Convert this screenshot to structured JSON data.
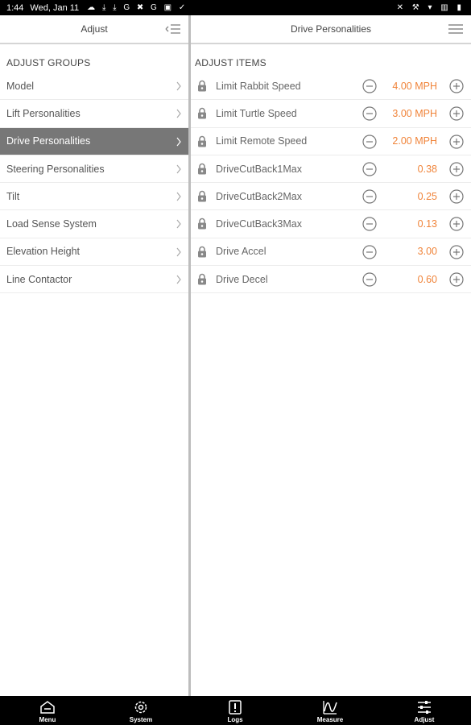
{
  "status_bar": {
    "time": "1:44",
    "date": "Wed, Jan 11",
    "notif_icons": "☁ ⤓ ⤓ G ✖ G ▣ ✓",
    "system_icons": "✕ ⚒ ▾ ▥ ▮"
  },
  "left": {
    "title": "Adjust",
    "section": "ADJUST GROUPS",
    "groups": [
      {
        "label": "Model"
      },
      {
        "label": "Lift Personalities"
      },
      {
        "label": "Drive Personalities"
      },
      {
        "label": "Steering Personalities"
      },
      {
        "label": "Tilt"
      },
      {
        "label": "Load Sense System"
      },
      {
        "label": "Elevation Height"
      },
      {
        "label": "Line Contactor"
      }
    ],
    "selected": "Drive Personalities"
  },
  "right": {
    "title": "Drive Personalities",
    "section": "ADJUST ITEMS",
    "items": [
      {
        "name": "Limit Rabbit Speed",
        "value": "4.00 MPH"
      },
      {
        "name": "Limit Turtle Speed",
        "value": "3.00 MPH"
      },
      {
        "name": "Limit Remote Speed",
        "value": "2.00 MPH"
      },
      {
        "name": "DriveCutBack1Max",
        "value": "0.38"
      },
      {
        "name": "DriveCutBack2Max",
        "value": "0.25"
      },
      {
        "name": "DriveCutBack3Max",
        "value": "0.13"
      },
      {
        "name": "Drive Accel",
        "value": "3.00"
      },
      {
        "name": "Drive Decel",
        "value": "0.60"
      }
    ]
  },
  "nav": {
    "menu": "Menu",
    "system": "System",
    "logs": "Logs",
    "measure": "Measure",
    "adjust": "Adjust"
  },
  "colors": {
    "value": "#f0843a",
    "selected_bg": "#777777",
    "bar": "#000000"
  }
}
